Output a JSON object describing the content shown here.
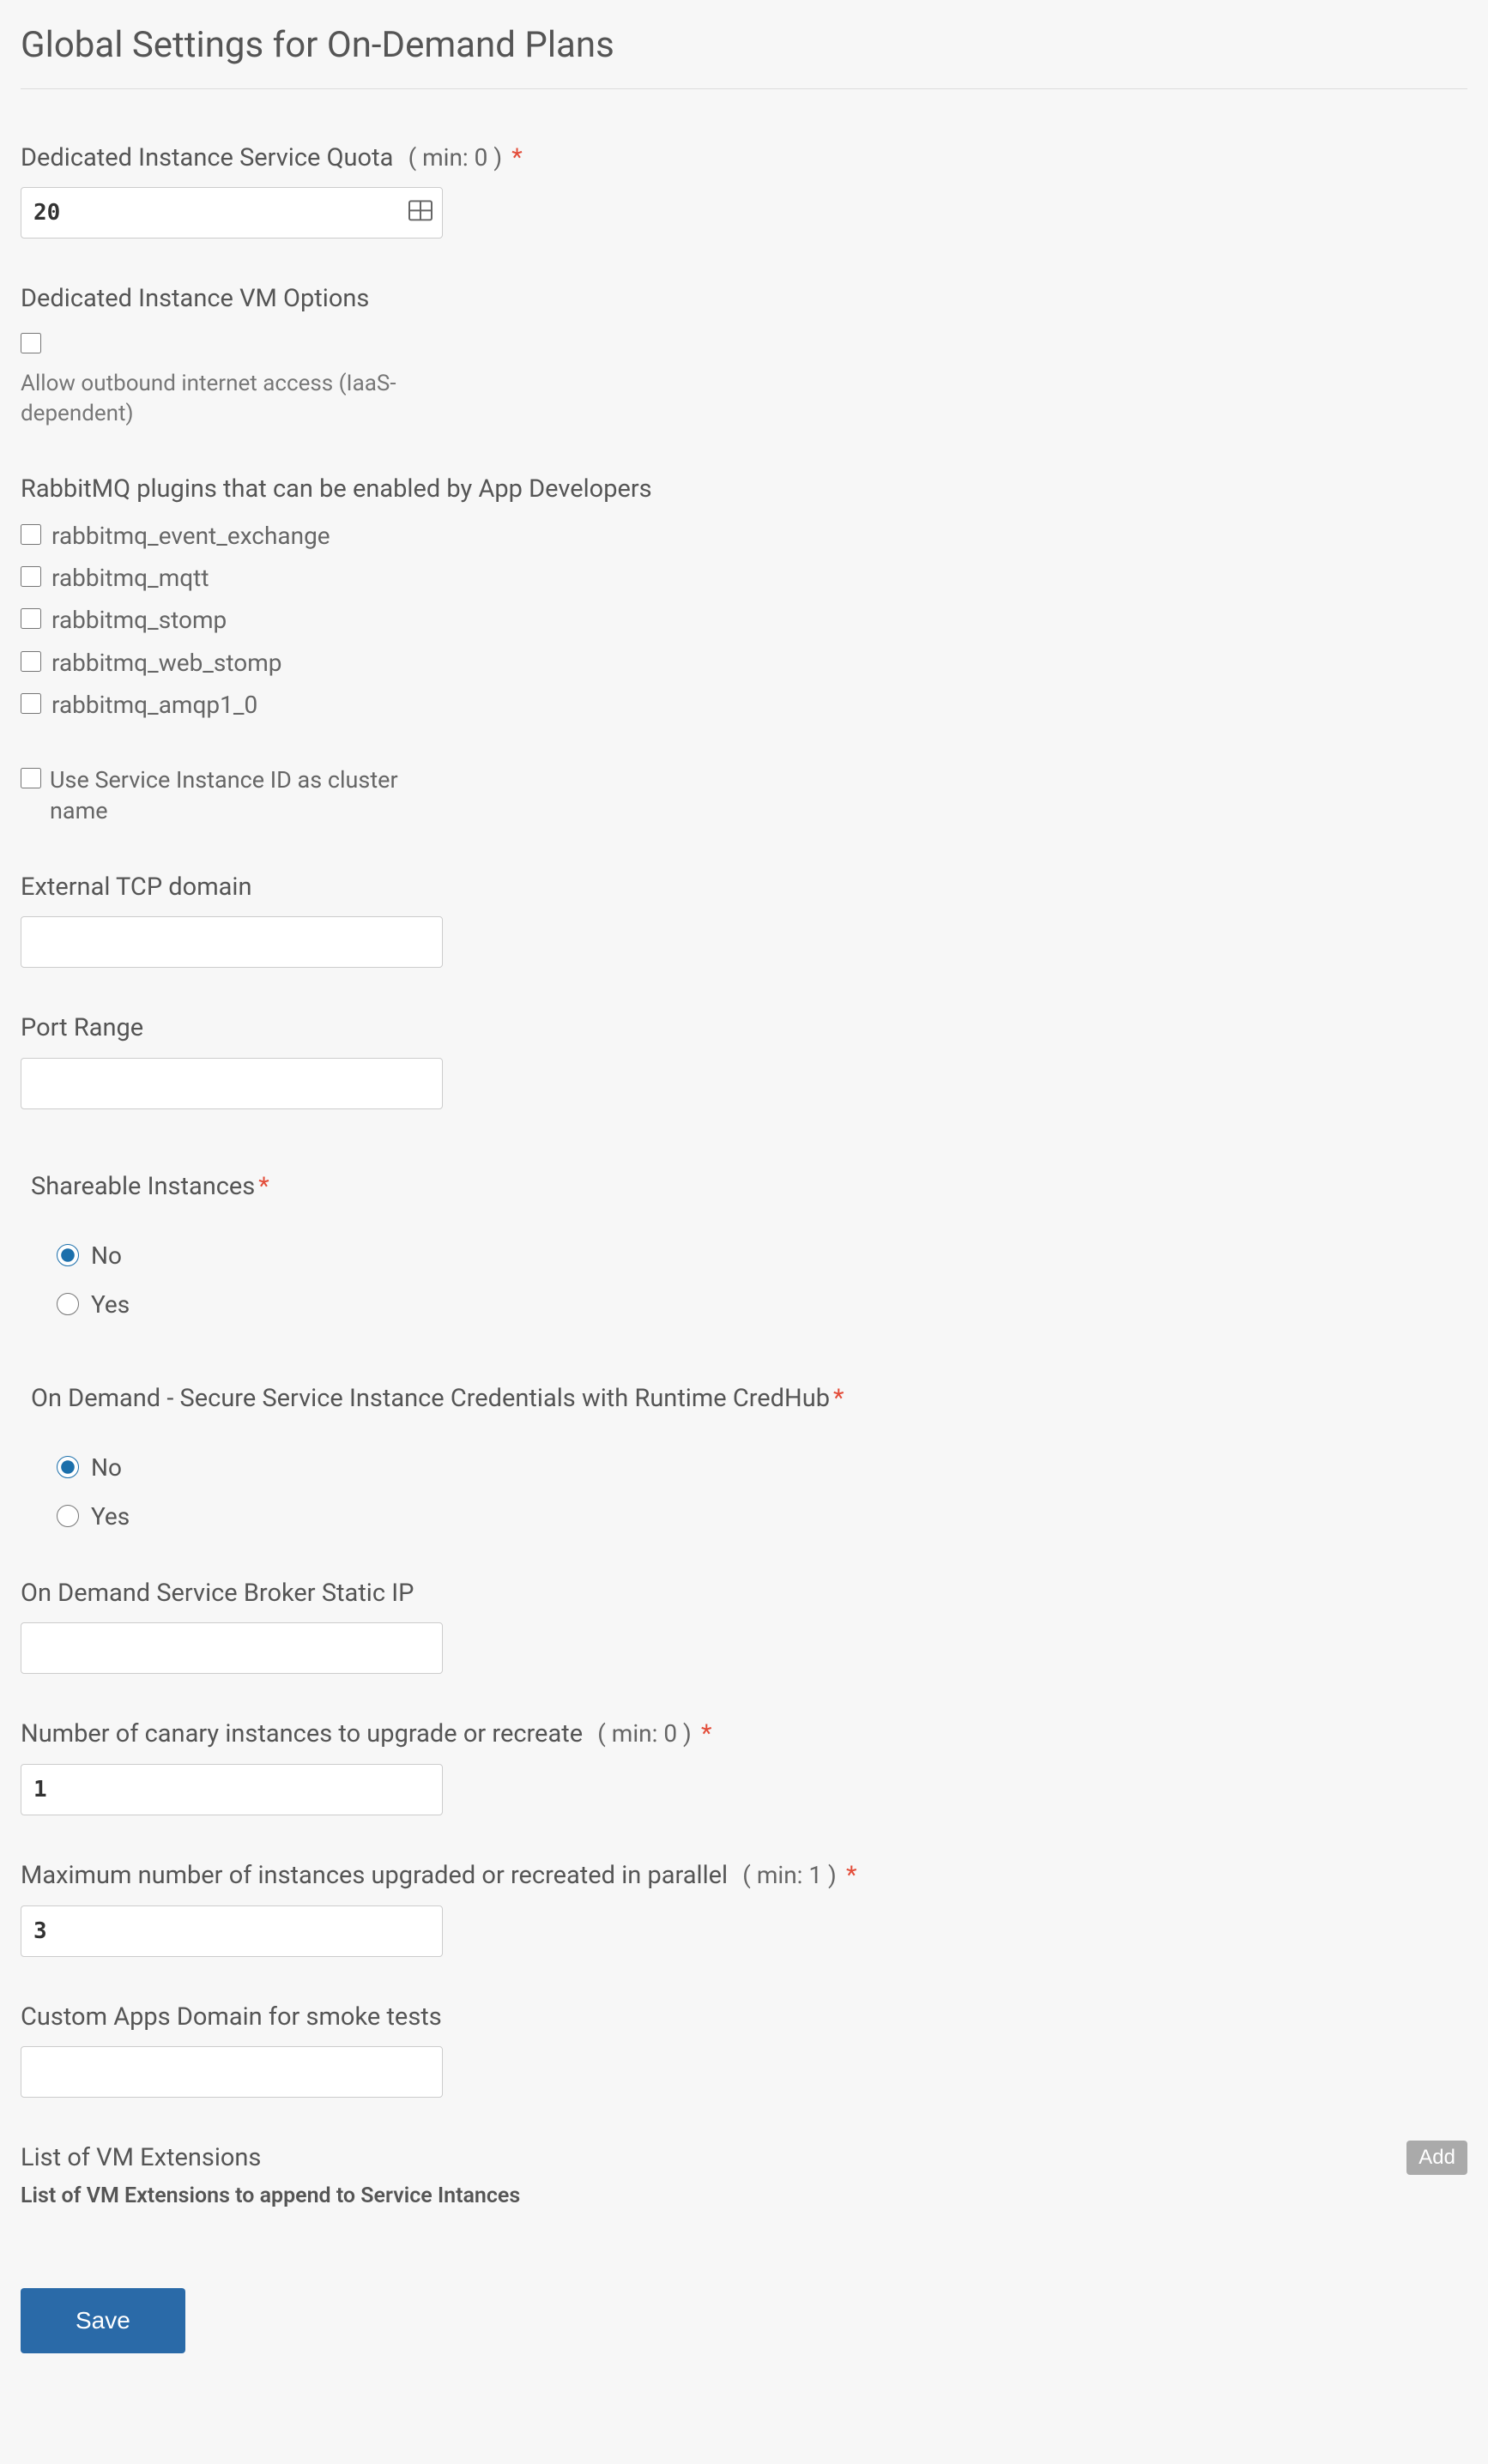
{
  "title": "Global Settings for On-Demand Plans",
  "quota": {
    "label": "Dedicated Instance Service Quota",
    "hint": "( min: 0 )",
    "value": "20"
  },
  "vm_options": {
    "label": "Dedicated Instance VM Options",
    "outbound_label": "Allow outbound internet access (IaaS-dependent)"
  },
  "plugins": {
    "label": "RabbitMQ plugins that can be enabled by App Developers",
    "items": [
      "rabbitmq_event_exchange",
      "rabbitmq_mqtt",
      "rabbitmq_stomp",
      "rabbitmq_web_stomp",
      "rabbitmq_amqp1_0"
    ]
  },
  "cluster_name": {
    "label": "Use Service Instance ID as cluster name"
  },
  "tcp_domain": {
    "label": "External TCP domain",
    "value": ""
  },
  "port_range": {
    "label": "Port Range",
    "value": ""
  },
  "shareable": {
    "label": "Shareable Instances",
    "options": {
      "no": "No",
      "yes": "Yes"
    },
    "selected": "no"
  },
  "credhub": {
    "label": "On Demand - Secure Service Instance Credentials with Runtime CredHub",
    "options": {
      "no": "No",
      "yes": "Yes"
    },
    "selected": "no"
  },
  "static_ip": {
    "label": "On Demand Service Broker Static IP",
    "value": ""
  },
  "canary": {
    "label": "Number of canary instances to upgrade or recreate",
    "hint": "( min: 0 )",
    "value": "1"
  },
  "parallel": {
    "label": "Maximum number of instances upgraded or recreated in parallel",
    "hint": "( min: 1 )",
    "value": "3"
  },
  "smoke_domain": {
    "label": "Custom Apps Domain for smoke tests",
    "value": ""
  },
  "vm_extensions": {
    "label": "List of VM Extensions",
    "sub": "List of VM Extensions to append to Service Intances",
    "add_label": "Add"
  },
  "save_label": "Save"
}
